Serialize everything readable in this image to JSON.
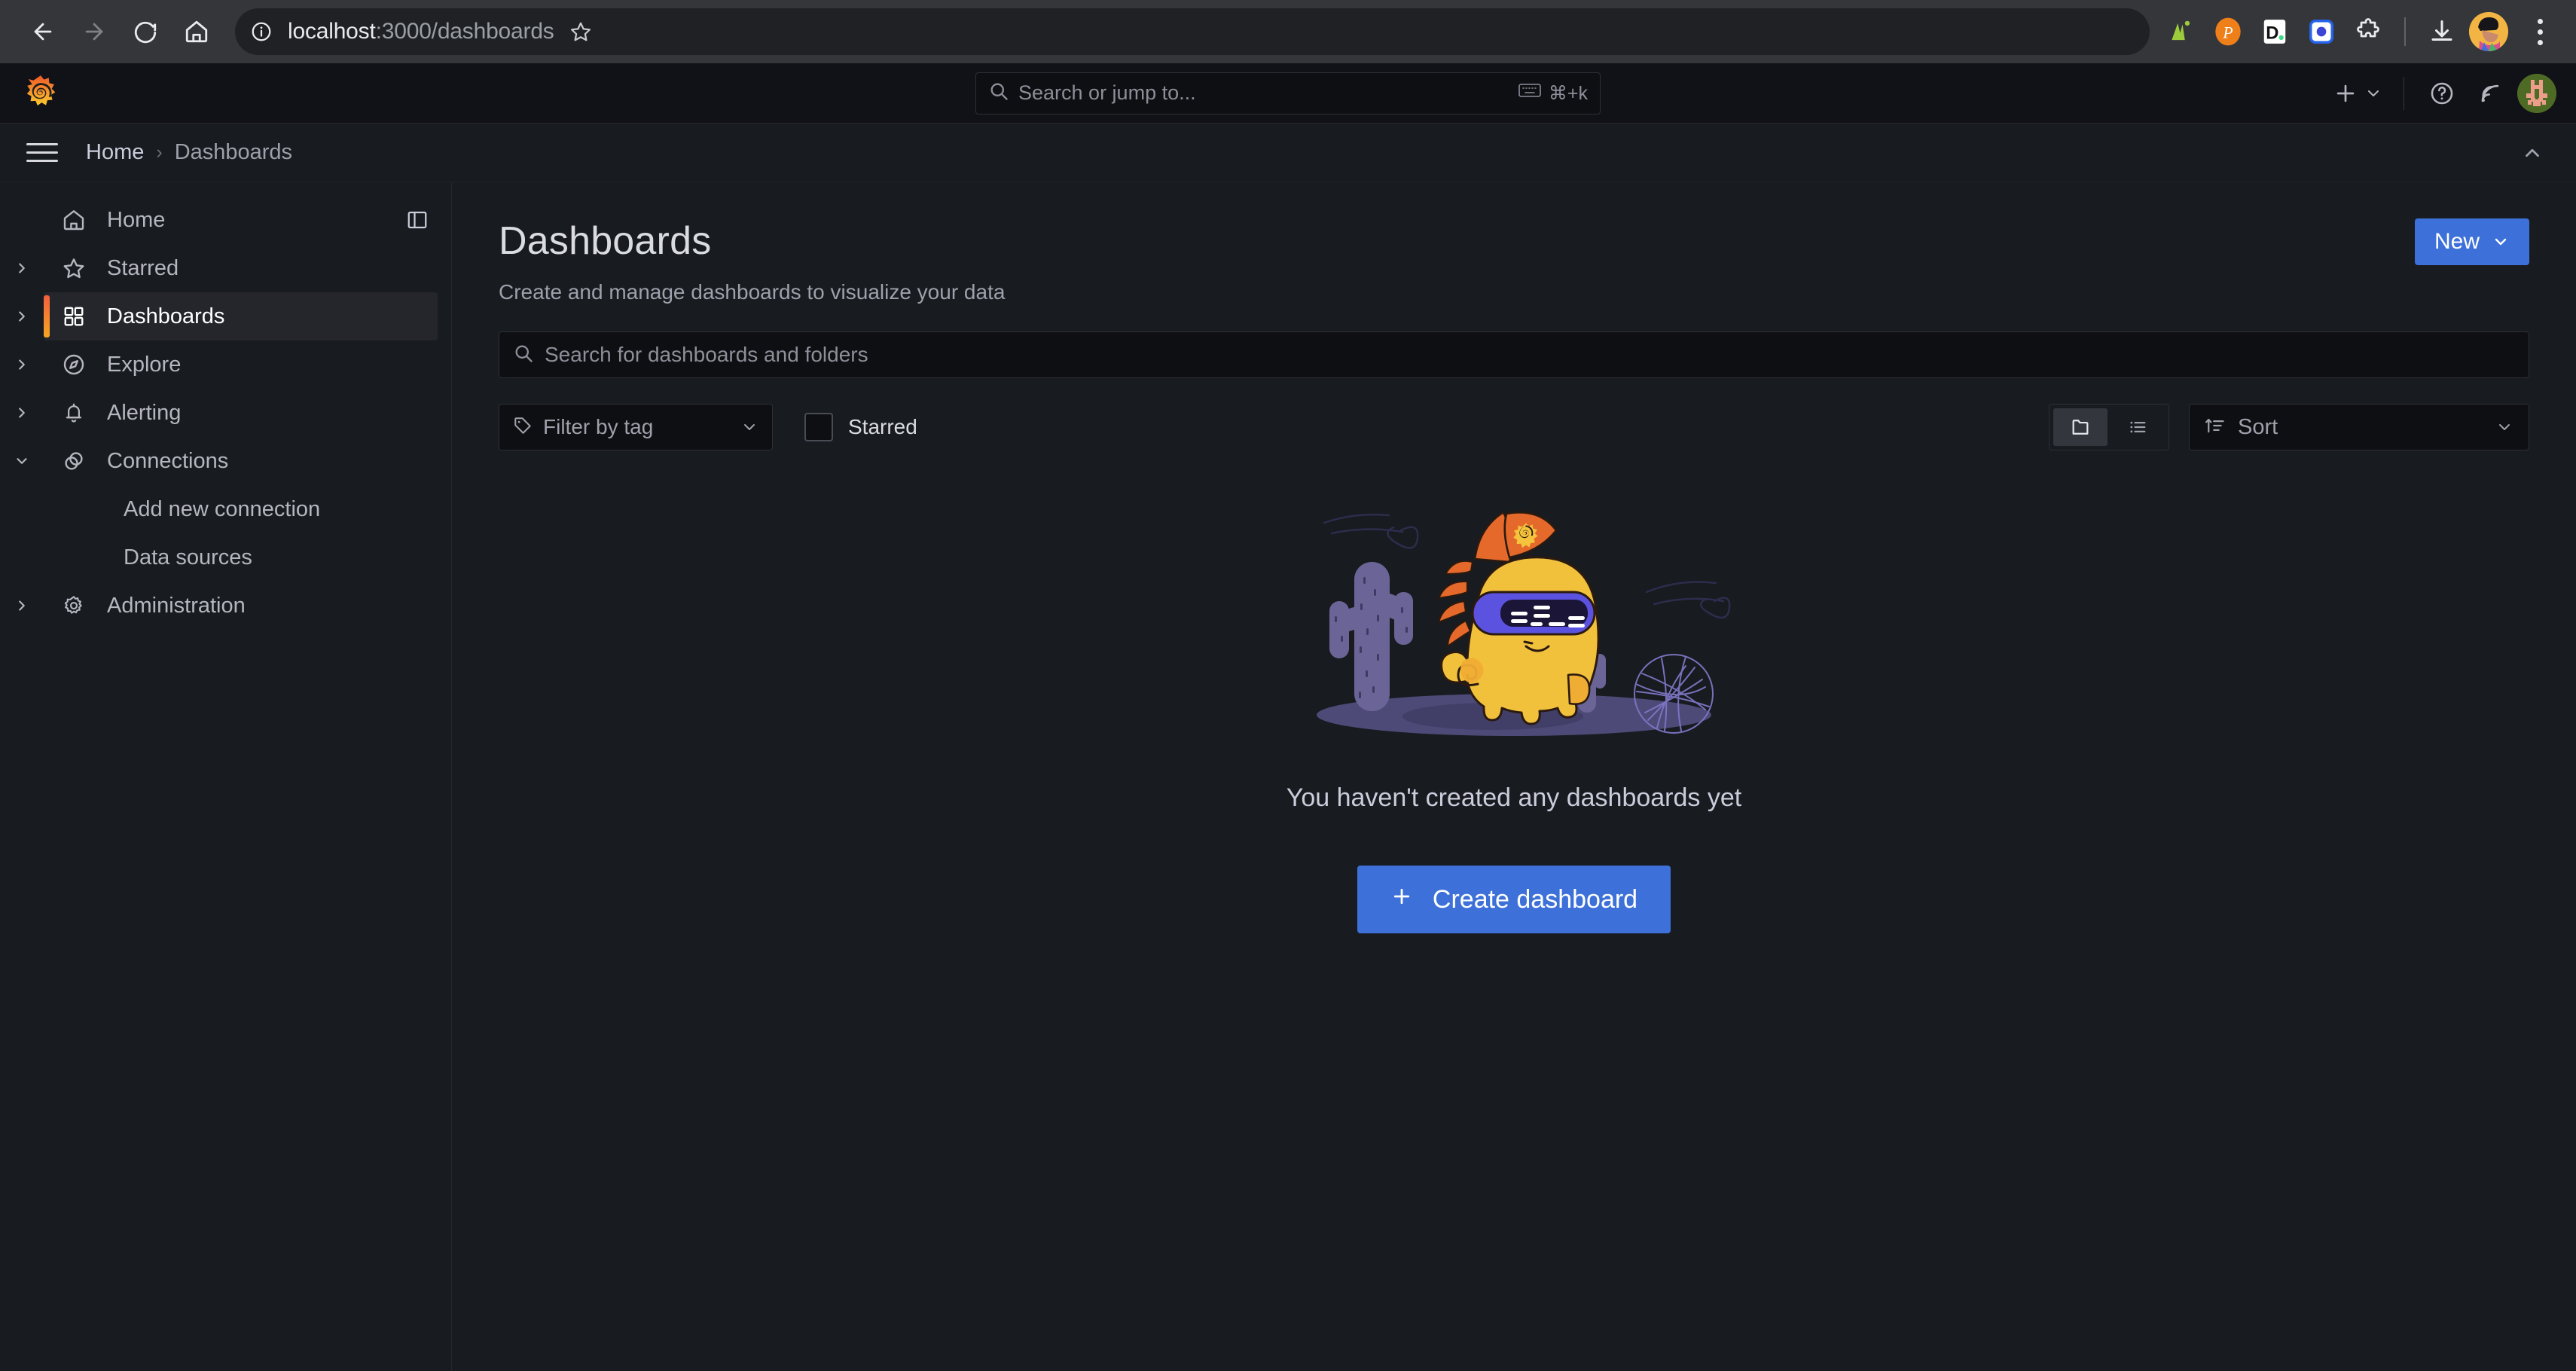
{
  "browser": {
    "url_host": "localhost",
    "url_path": ":3000/dashboards",
    "back_icon": "back-arrow-icon",
    "forward_icon": "forward-arrow-icon",
    "reload_icon": "reload-icon",
    "home_icon": "home-icon",
    "site_info_icon": "site-info-icon",
    "bookmark_icon": "bookmark-star-icon",
    "extensions": [
      {
        "name": "extension-analytics",
        "label": "A"
      },
      {
        "name": "extension-pocket",
        "label": "P"
      },
      {
        "name": "extension-d",
        "label": "D."
      },
      {
        "name": "extension-blue-square",
        "label": "O"
      },
      {
        "name": "extension-puzzle",
        "label": "Extensions"
      }
    ],
    "download_icon": "download-icon",
    "profile_icon": "chrome-profile-avatar",
    "menu_icon": "chrome-menu-icon"
  },
  "topnav": {
    "logo": "grafana-logo",
    "search_placeholder": "Search or jump to...",
    "search_shortcut": "⌘+k",
    "keyboard_icon": "keyboard-icon",
    "plus_label": "+",
    "help_icon": "help-circle-icon",
    "news_icon": "news-rss-icon",
    "avatar": "user-avatar"
  },
  "breadcrumb": {
    "menu_icon": "hamburger-menu-icon",
    "items": [
      {
        "label": "Home"
      },
      {
        "label": "Dashboards"
      }
    ],
    "separator": "›",
    "collapse_icon": "chevron-up-icon"
  },
  "sidebar": {
    "dock_icon": "dock-menu-icon",
    "items": [
      {
        "label": "Home",
        "icon": "home-icon",
        "expandable": false,
        "active": false,
        "child": false
      },
      {
        "label": "Starred",
        "icon": "star-icon",
        "expandable": true,
        "expanded": false,
        "active": false,
        "child": false
      },
      {
        "label": "Dashboards",
        "icon": "dashboards-grid-icon",
        "expandable": true,
        "expanded": false,
        "active": true,
        "child": false
      },
      {
        "label": "Explore",
        "icon": "compass-icon",
        "expandable": true,
        "expanded": false,
        "active": false,
        "child": false
      },
      {
        "label": "Alerting",
        "icon": "bell-icon",
        "expandable": true,
        "expanded": false,
        "active": false,
        "child": false
      },
      {
        "label": "Connections",
        "icon": "connections-icon",
        "expandable": true,
        "expanded": true,
        "active": false,
        "child": false
      },
      {
        "label": "Add new connection",
        "icon": "",
        "expandable": false,
        "active": false,
        "child": true
      },
      {
        "label": "Data sources",
        "icon": "",
        "expandable": false,
        "active": false,
        "child": true
      },
      {
        "label": "Administration",
        "icon": "gear-icon",
        "expandable": true,
        "expanded": false,
        "active": false,
        "child": false
      }
    ]
  },
  "main": {
    "title": "Dashboards",
    "subtitle": "Create and manage dashboards to visualize your data",
    "new_button": {
      "label": "New",
      "chevron": "chevron-down-icon",
      "color": "#3d71d9"
    },
    "search": {
      "placeholder": "Search for dashboards and folders",
      "value": "",
      "icon": "search-icon"
    },
    "filters": {
      "tag_filter": {
        "label": "Filter by tag",
        "icon": "tag-icon",
        "chevron": "chevron-down-icon"
      },
      "starred": {
        "label": "Starred",
        "checked": false
      }
    },
    "view_toggle": {
      "folder_view": {
        "name": "folder-view",
        "active": true,
        "icon": "folder-icon"
      },
      "list_view": {
        "name": "list-view",
        "active": false,
        "icon": "list-icon"
      }
    },
    "sort": {
      "label": "Sort",
      "icon": "sort-ascending-icon",
      "chevron": "chevron-down-icon"
    },
    "empty_state": {
      "illustration": "grafana-mascot-vr-cactus-illustration",
      "title": "You haven't created any dashboards yet",
      "button": {
        "label": "Create dashboard",
        "icon": "plus-icon",
        "color": "#3d71d9"
      }
    }
  },
  "colors": {
    "page_bg": "#181b1f",
    "topnav_bg": "#111217",
    "input_bg": "#0e0f12",
    "border": "#2c2f36",
    "primary": "#3d71d9",
    "accent_orange": "#f55f3e",
    "text_primary": "#ccccdc",
    "text_secondary": "#9fa0ab"
  }
}
